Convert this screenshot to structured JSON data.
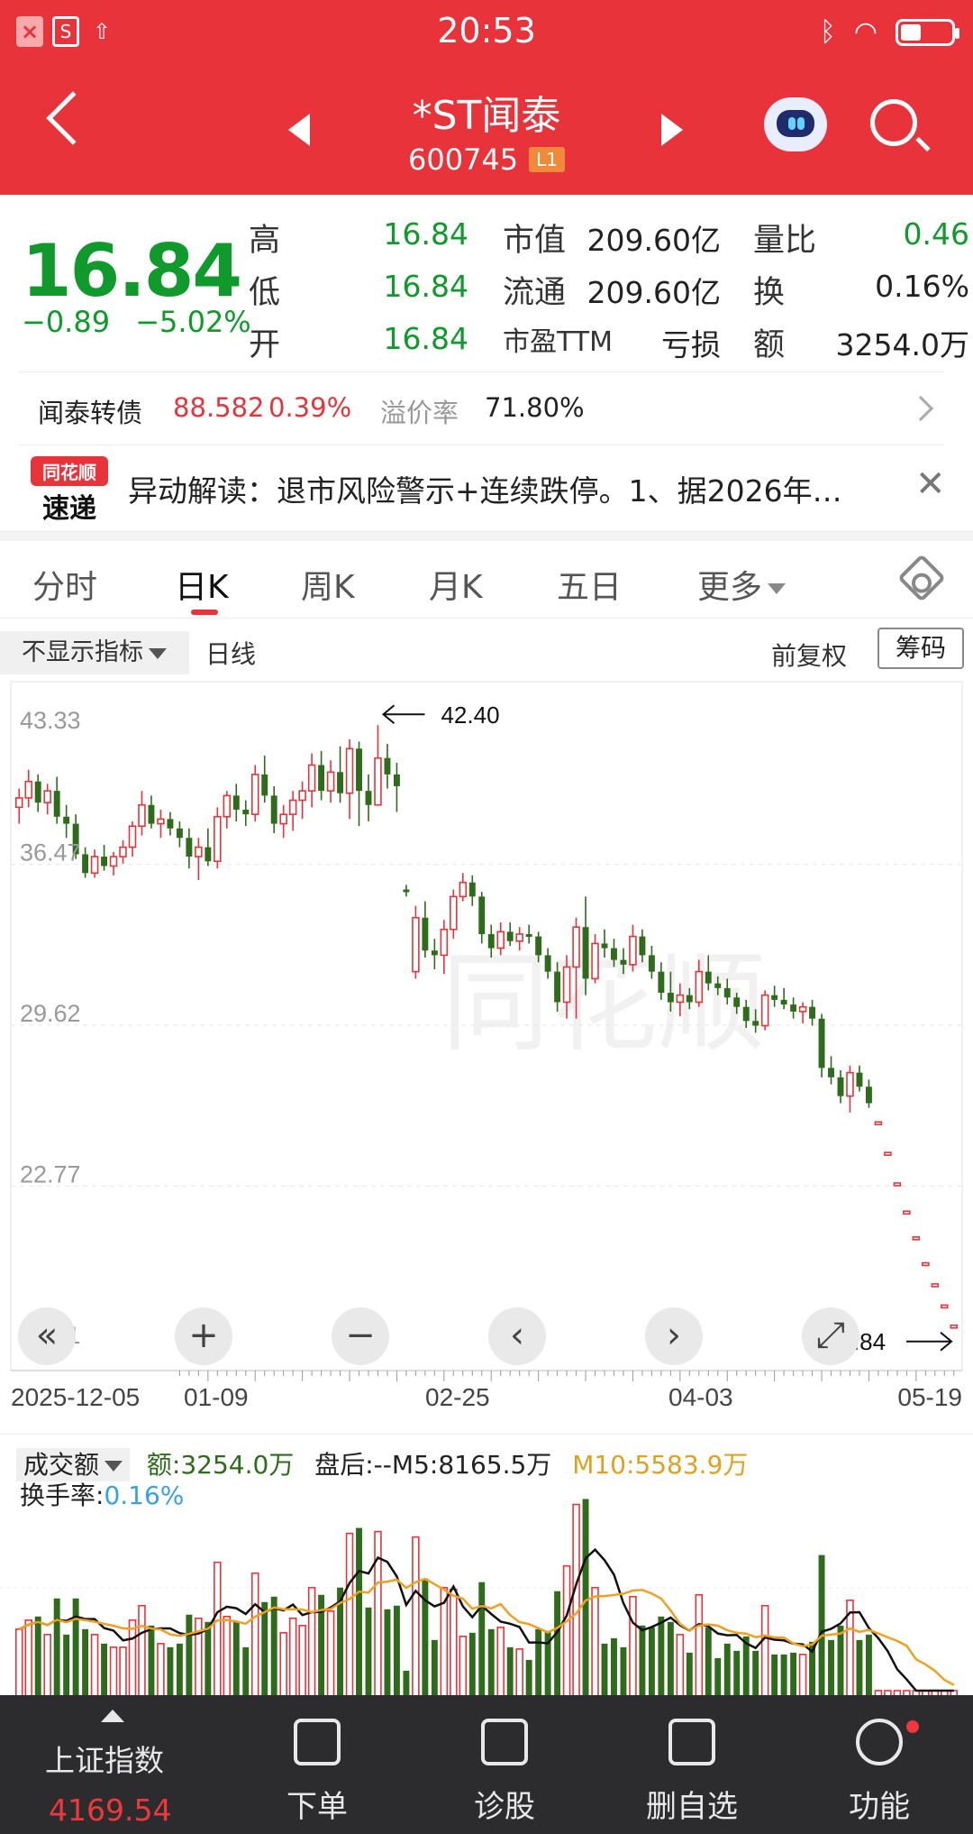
{
  "status_bar": {
    "time": "20:53"
  },
  "header": {
    "stock_name": "*ST闻泰",
    "stock_code": "600745",
    "level": "L1"
  },
  "quote": {
    "price": "16.84",
    "change": "−0.89",
    "change_pct": "−5.02%",
    "high_label": "高",
    "high": "16.84",
    "low_label": "低",
    "low": "16.84",
    "open_label": "开",
    "open": "16.84",
    "mktcap_label": "市值",
    "mktcap": "209.60亿",
    "float_label": "流通",
    "float_cap": "209.60亿",
    "pe_label": "市盈TTM",
    "pe": "亏损",
    "vol_ratio_label": "量比",
    "vol_ratio": "0.46",
    "turnover_label": "换",
    "turnover": "0.16%",
    "amount_label": "额",
    "amount": "3254.0万"
  },
  "bond": {
    "name": "闻泰转债",
    "price": "88.582",
    "pct": "0.39%",
    "premium_label": "溢价率",
    "premium": "71.80%"
  },
  "news": {
    "logo_top": "同花顺",
    "logo_bottom": "速递",
    "text": "异动解读：退市风险警示+连续跌停。1、据2026年…"
  },
  "tabs": [
    "分时",
    "日K",
    "周K",
    "月K",
    "五日",
    "更多"
  ],
  "indicator_bar": {
    "selector": "不显示指标",
    "daily": "日线",
    "adjust": "前复权",
    "chip": "筹码"
  },
  "chart_data": {
    "type": "candlestick",
    "y_ticks": [
      "43.33",
      "36.47",
      "29.62",
      "22.77",
      "15.91"
    ],
    "x_ticks": [
      "2025-12-05",
      "01-09",
      "02-25",
      "04-03",
      "05-19"
    ],
    "ylim": [
      15.91,
      43.33
    ],
    "max_label": "42.40",
    "last_label": "16.84",
    "watermark": "同花顺",
    "candles": [
      [
        38.9,
        39.7,
        38.2,
        39.3
      ],
      [
        39.3,
        40.5,
        38.9,
        40.0
      ],
      [
        40.0,
        40.3,
        38.7,
        39.1
      ],
      [
        39.1,
        39.9,
        38.6,
        39.6
      ],
      [
        39.6,
        40.2,
        38.2,
        38.5
      ],
      [
        38.5,
        39.0,
        37.6,
        38.2
      ],
      [
        38.2,
        38.6,
        36.7,
        36.9
      ],
      [
        36.9,
        37.2,
        35.9,
        36.1
      ],
      [
        36.1,
        37.1,
        35.9,
        36.8
      ],
      [
        36.8,
        37.3,
        36.2,
        36.4
      ],
      [
        36.4,
        37.0,
        36.0,
        36.8
      ],
      [
        36.8,
        37.5,
        36.5,
        37.2
      ],
      [
        37.2,
        38.3,
        36.8,
        38.1
      ],
      [
        38.1,
        39.6,
        37.7,
        39.0
      ],
      [
        39.0,
        39.4,
        38.0,
        38.2
      ],
      [
        38.2,
        38.8,
        37.6,
        38.4
      ],
      [
        38.4,
        38.7,
        37.7,
        38.0
      ],
      [
        38.0,
        38.3,
        37.2,
        37.6
      ],
      [
        37.6,
        38.0,
        36.3,
        36.8
      ],
      [
        36.8,
        37.6,
        35.8,
        37.2
      ],
      [
        37.2,
        38.0,
        36.4,
        36.6
      ],
      [
        36.6,
        38.9,
        36.3,
        38.5
      ],
      [
        38.5,
        39.6,
        38.0,
        39.4
      ],
      [
        39.4,
        39.9,
        38.3,
        38.8
      ],
      [
        38.8,
        39.2,
        38.1,
        38.6
      ],
      [
        38.6,
        40.7,
        38.3,
        40.3
      ],
      [
        40.3,
        41.1,
        39.1,
        39.4
      ],
      [
        39.4,
        39.8,
        37.8,
        38.2
      ],
      [
        38.2,
        39.0,
        37.6,
        38.6
      ],
      [
        38.6,
        39.6,
        37.9,
        39.2
      ],
      [
        39.2,
        40.0,
        38.4,
        39.6
      ],
      [
        39.6,
        41.2,
        38.9,
        40.7
      ],
      [
        40.7,
        41.3,
        39.2,
        39.6
      ],
      [
        39.6,
        40.9,
        39.1,
        40.4
      ],
      [
        40.4,
        41.5,
        39.1,
        39.5
      ],
      [
        39.5,
        41.8,
        38.4,
        41.4
      ],
      [
        41.4,
        41.7,
        38.1,
        39.6
      ],
      [
        39.6,
        40.3,
        38.3,
        39.0
      ],
      [
        39.0,
        42.4,
        39.0,
        41.0
      ],
      [
        41.0,
        41.6,
        39.7,
        40.3
      ],
      [
        40.3,
        40.8,
        38.7,
        39.8
      ],
      [
        35.4,
        35.6,
        35.1,
        35.3
      ],
      [
        31.9,
        34.7,
        31.6,
        34.2
      ],
      [
        34.2,
        34.9,
        32.5,
        32.8
      ],
      [
        32.8,
        33.3,
        32.0,
        32.6
      ],
      [
        32.6,
        34.1,
        31.8,
        33.7
      ],
      [
        33.7,
        35.4,
        33.3,
        35.1
      ],
      [
        35.1,
        36.1,
        34.9,
        35.7
      ],
      [
        35.7,
        36.0,
        34.7,
        35.1
      ],
      [
        35.1,
        35.3,
        33.1,
        33.5
      ],
      [
        33.5,
        33.9,
        32.5,
        32.9
      ],
      [
        32.9,
        34.0,
        32.6,
        33.6
      ],
      [
        33.6,
        34.0,
        33.0,
        33.2
      ],
      [
        33.2,
        33.8,
        32.8,
        33.5
      ],
      [
        33.5,
        33.9,
        33.1,
        33.4
      ],
      [
        33.4,
        33.6,
        32.3,
        32.6
      ],
      [
        32.6,
        32.9,
        31.6,
        31.9
      ],
      [
        31.9,
        32.3,
        30.2,
        30.6
      ],
      [
        30.6,
        32.6,
        29.9,
        32.1
      ],
      [
        32.1,
        34.2,
        29.9,
        33.8
      ],
      [
        33.8,
        35.1,
        30.9,
        31.6
      ],
      [
        31.6,
        33.5,
        31.4,
        33.1
      ],
      [
        33.1,
        33.7,
        32.5,
        32.9
      ],
      [
        32.9,
        33.3,
        32.1,
        32.4
      ],
      [
        32.4,
        32.9,
        31.8,
        32.2
      ],
      [
        32.2,
        33.9,
        31.9,
        33.4
      ],
      [
        33.4,
        33.7,
        32.3,
        32.6
      ],
      [
        32.6,
        33.0,
        31.6,
        31.9
      ],
      [
        31.9,
        32.3,
        30.7,
        31.0
      ],
      [
        31.0,
        31.9,
        30.2,
        30.6
      ],
      [
        30.6,
        31.4,
        30.0,
        30.9
      ],
      [
        30.9,
        31.2,
        30.3,
        30.6
      ],
      [
        30.6,
        32.4,
        30.4,
        31.9
      ],
      [
        31.9,
        32.6,
        31.1,
        31.4
      ],
      [
        31.4,
        31.7,
        30.9,
        31.2
      ],
      [
        31.2,
        31.6,
        30.5,
        30.8
      ],
      [
        30.8,
        31.0,
        30.1,
        30.4
      ],
      [
        30.4,
        30.7,
        29.5,
        29.8
      ],
      [
        29.8,
        30.3,
        29.3,
        29.6
      ],
      [
        29.6,
        31.1,
        29.4,
        30.9
      ],
      [
        30.9,
        31.3,
        30.4,
        30.7
      ],
      [
        30.7,
        31.2,
        30.3,
        30.5
      ],
      [
        30.5,
        30.8,
        29.9,
        30.2
      ],
      [
        30.2,
        30.6,
        29.7,
        30.4
      ],
      [
        30.4,
        30.7,
        29.6,
        29.9
      ],
      [
        29.9,
        30.1,
        27.4,
        27.8
      ],
      [
        27.8,
        28.3,
        27.1,
        27.4
      ],
      [
        27.4,
        27.7,
        26.3,
        26.6
      ],
      [
        26.6,
        27.9,
        25.9,
        27.6
      ],
      [
        27.6,
        27.9,
        26.8,
        27.0
      ],
      [
        27.0,
        27.3,
        26.1,
        26.3
      ],
      [
        25.5,
        25.5,
        25.5,
        25.5
      ],
      [
        24.2,
        24.2,
        24.2,
        24.2
      ],
      [
        22.9,
        22.9,
        22.9,
        22.9
      ],
      [
        21.7,
        21.7,
        21.7,
        21.7
      ],
      [
        20.6,
        20.6,
        20.6,
        20.6
      ],
      [
        19.5,
        19.5,
        19.5,
        19.5
      ],
      [
        18.6,
        18.6,
        18.6,
        18.6
      ],
      [
        17.7,
        17.7,
        17.7,
        17.7
      ],
      [
        16.84,
        16.84,
        16.84,
        16.84
      ]
    ]
  },
  "volume": {
    "selector": "成交额",
    "amount_text": "额:3254.0万",
    "after_text": "盘后:--",
    "m5_text": "M5:8165.5万",
    "m10_text": "M10:5583.9万",
    "turnover_label": "换手率:",
    "turnover_value": "0.16%"
  },
  "bottom_nav": {
    "index_name": "上证指数",
    "index_value": "4169.54",
    "items": [
      "下单",
      "诊股",
      "删自选",
      "功能"
    ]
  },
  "colors": {
    "up": "#e8333a",
    "down": "#2e6b1b",
    "m5": "#111111",
    "m10": "#f0a020",
    "turnover": "#35a3e0"
  }
}
